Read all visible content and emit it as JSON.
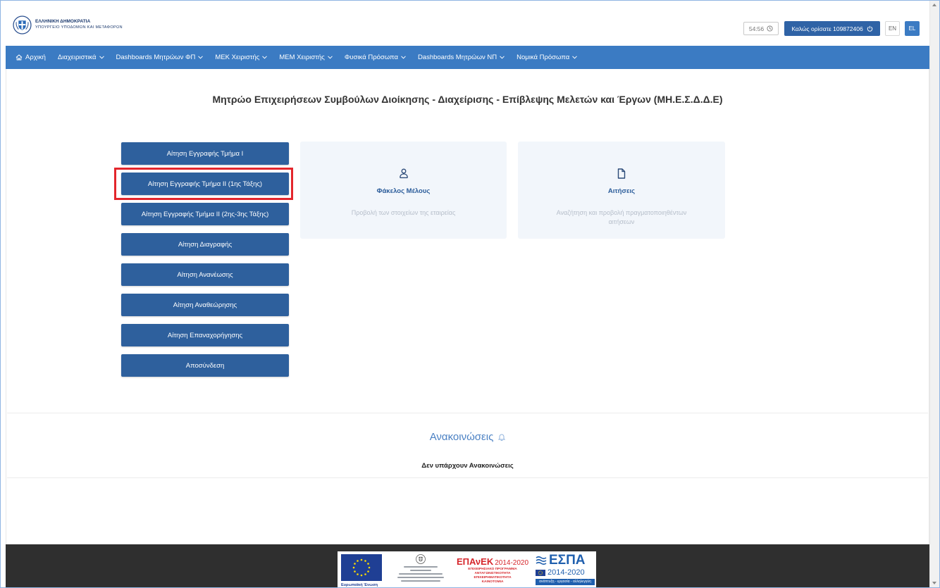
{
  "colors": {
    "nav_bg": "#3b7bc3",
    "action_button_bg": "#2e609d",
    "card_bg": "#f2f6fb",
    "highlight_border": "#e3262c",
    "footer_bg": "#2f2f2f",
    "accent_text": "#2b5c9a"
  },
  "header": {
    "logo": {
      "icon": "greek-emblem-icon",
      "title": "ΕΛΛΗΝΙΚΗ ΔΗΜΟΚΡΑΤΙΑ",
      "subtitle": "ΥΠΟΥΡΓΕΙΟ ΥΠΟΔΟΜΩΝ ΚΑΙ ΜΕΤΑΦΟΡΩΝ"
    },
    "session_timer": {
      "value": "54:56",
      "icon": "clock-icon"
    },
    "user_button": {
      "label": "Καλώς ορίσατε 109872406",
      "icon": "power-icon"
    },
    "languages": [
      {
        "label": "EN",
        "active": false
      },
      {
        "label": "EL",
        "active": true
      }
    ]
  },
  "nav": {
    "items": [
      {
        "label": "Αρχική",
        "icon": "home-icon",
        "has_dropdown": false
      },
      {
        "label": "Διαχειριστικά",
        "has_dropdown": true
      },
      {
        "label": "Dashboards Μητρώων ΦΠ",
        "has_dropdown": true
      },
      {
        "label": "ΜΕΚ Χειριστής",
        "has_dropdown": true
      },
      {
        "label": "ΜΕΜ Χειριστής",
        "has_dropdown": true
      },
      {
        "label": "Φυσικά Πρόσωπα",
        "has_dropdown": true
      },
      {
        "label": "Dashboards Μητρώων ΝΠ",
        "has_dropdown": true
      },
      {
        "label": "Νομικά Πρόσωπα",
        "has_dropdown": true
      }
    ]
  },
  "main": {
    "title": "Μητρώο Επιχειρήσεων Συμβούλων Διοίκησης - Διαχείρισης - Επίβλεψης Μελετών και Έργων (ΜΗ.Ε.Σ.Δ.Δ.Ε)",
    "actions": [
      {
        "label": "Αίτηση Εγγραφής Τμήμα I"
      },
      {
        "label": "Αίτηση Εγγραφής Τμήμα II (1ης Τάξης)"
      },
      {
        "label": "Αίτηση Εγγραφής Τμήμα II (2ης-3ης Τάξης)"
      },
      {
        "label": "Αίτηση Διαγραφής"
      },
      {
        "label": "Αίτηση Ανανέωσης"
      },
      {
        "label": "Αίτηση Αναθεώρησης"
      },
      {
        "label": "Αίτηση Επαναχορήγησης"
      },
      {
        "label": "Αποσύνδεση"
      }
    ],
    "highlighted_action_index": 1,
    "cards": [
      {
        "icon": "user-icon",
        "title": "Φάκελος Μέλους",
        "description": "Προβολή των στοιχείων της εταιρείας"
      },
      {
        "icon": "file-icon",
        "title": "Αιτήσεις",
        "description": "Αναζήτηση και προβολή πραγματοποιηθέντων αιτήσεων"
      }
    ]
  },
  "announcements": {
    "title": "Ανακοινώσεις",
    "icon": "bell-icon",
    "empty_message": "Δεν υπάρχουν Ανακοινώσεις"
  },
  "footer": {
    "banner": {
      "eu": {
        "icon": "eu-flag-icon",
        "caption": "Ευρωπαϊκή Ένωση"
      },
      "ministry": {
        "icon": "greek-emblem-icon"
      },
      "epanek": {
        "name": "ΕΠΑνΕΚ",
        "period": "2014-2020",
        "lines": [
          "ΕΠΙΧΕΙΡΗΣΙΑΚΟ ΠΡΟΓΡΑΜΜΑ",
          "ΑΝΤΑΓΩΝΙΣΤΙΚΟΤΗΤΑ",
          "ΕΠΙΧΕΙΡΗΜΑΤΙΚΟΤΗΤΑ",
          "ΚΑΙΝΟΤΟΜΙΑ"
        ]
      },
      "espa": {
        "icon": "espa-waves-icon",
        "name": "ΕΣΠΑ",
        "period": "2014-2020",
        "slogan": "ανάπτυξη - εργασία - αλληλεγγύη"
      }
    }
  }
}
